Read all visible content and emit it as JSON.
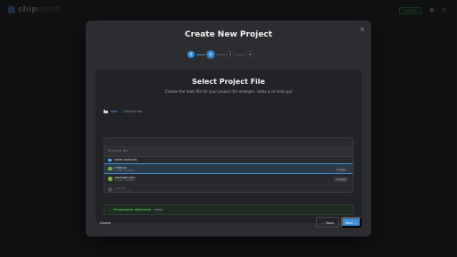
{
  "app": {
    "logo_prefix": "ship",
    "logo_suffix": "ment",
    "status": "Ready",
    "icons": [
      "logo-icon",
      "bell-icon",
      "settings-icon"
    ]
  },
  "modal": {
    "title": "Create New Project",
    "close_icon": "×",
    "steps": [
      {
        "label": "1",
        "state": "done"
      },
      {
        "label": "2",
        "state": "active"
      },
      {
        "label": "3",
        "state": "todo"
      },
      {
        "label": "4",
        "state": "todo"
      }
    ],
    "panel": {
      "title": "Select Project File",
      "subtitle": "Choose the main file for your project (for example, index.js or main.py)",
      "breadcrumb": {
        "root": "root",
        "separator": "/",
        "current": "Dreyard Bot"
      },
      "search": {
        "value": "",
        "placeholder": "Dreyard Bot"
      },
      "folder": {
        "name": "node_modules"
      },
      "files": [
        {
          "name": "index.js",
          "meta": "2.4 KB • modified",
          "tag": "nodejs",
          "selected": true
        },
        {
          "name": "package.json",
          "meta": "1.1 KB • modified",
          "tag": "nodejs",
          "selected": false
        },
        {
          "name": "bot.log",
          "meta": "512 B • modified",
          "tag": "",
          "selected": false
        }
      ],
      "detection": {
        "check": "✓",
        "label": "Framework detected:",
        "value": "nodejs"
      }
    },
    "buttons": {
      "cancel": "Cancel",
      "back": "← Back",
      "next": "Next →"
    }
  },
  "colors": {
    "accent": "#3a8fd6",
    "success": "#4caf50",
    "background": "#1a1b1d",
    "modal": "#2c2d30"
  }
}
